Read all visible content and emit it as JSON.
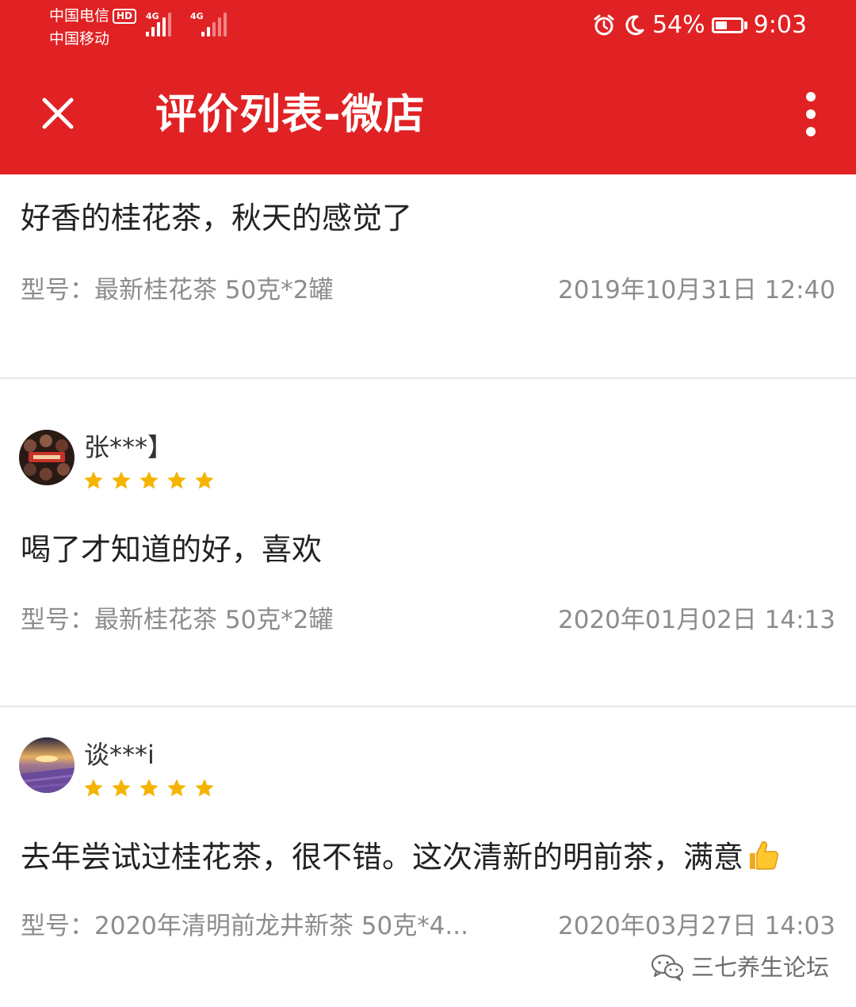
{
  "status_bar": {
    "carrier_1": "中国电信",
    "carrier_1_badge": "HD",
    "carrier_2": "中国移动",
    "network_1": "4G",
    "network_2": "4G",
    "battery": "54%",
    "battery_level": 0.54,
    "time": "9:03"
  },
  "header": {
    "title": "评价列表-微店",
    "close_icon": "close-icon",
    "more_icon": "more-vertical-icon",
    "background_color": "#e02224"
  },
  "reviews": [
    {
      "content": "好香的桂花茶，秋天的感觉了",
      "model": "型号：最新桂花茶 50克*2罐",
      "datetime": "2019年10月31日 12:40"
    },
    {
      "username": "张***】",
      "rating": 5,
      "content": "喝了才知道的好，喜欢",
      "model": "型号：最新桂花茶 50克*2罐",
      "datetime": "2020年01月02日 14:13"
    },
    {
      "username": "谈***i",
      "rating": 5,
      "content": "去年尝试过桂花茶，很不错。这次清新的明前茶，满意",
      "model": "型号：2020年清明前龙井新茶 50克*4...",
      "datetime": "2020年03月27日 14:03"
    }
  ],
  "star_color": "#f5b400",
  "watermark": {
    "text": "三七养生论坛",
    "icon": "wechat-icon"
  }
}
